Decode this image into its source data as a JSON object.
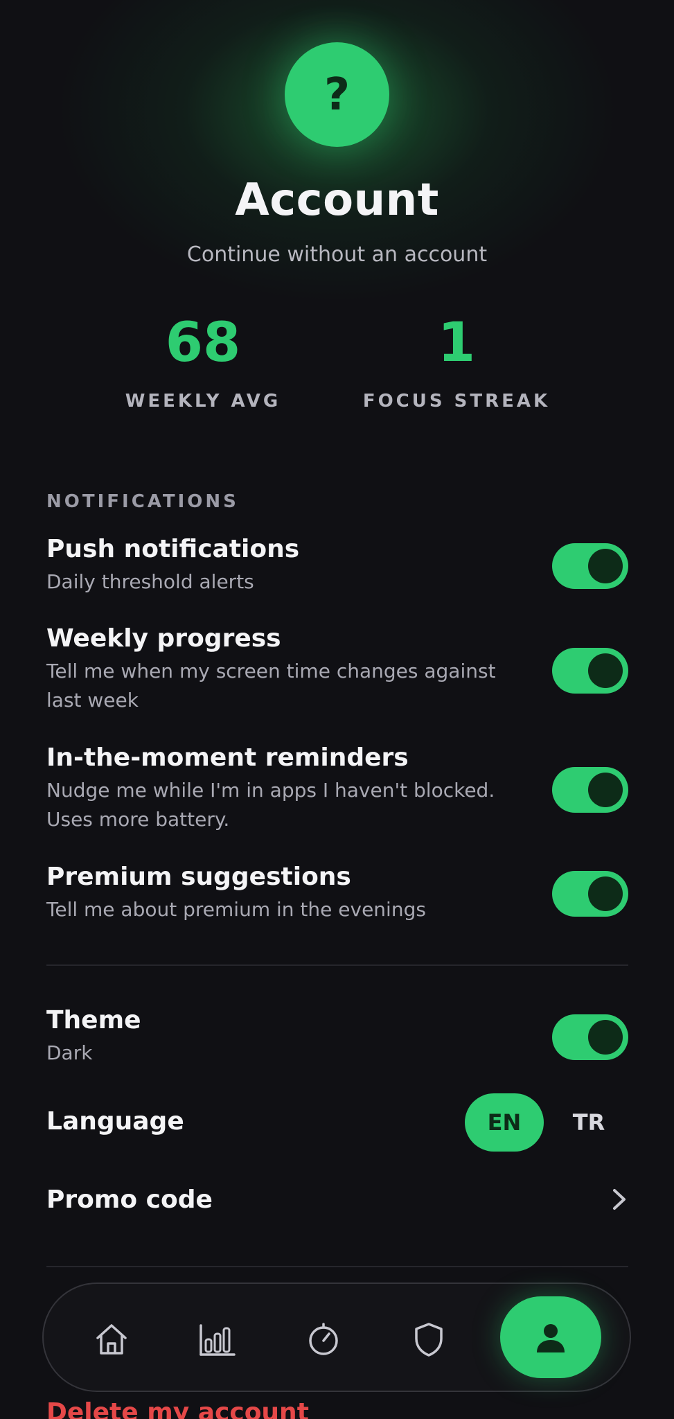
{
  "header": {
    "avatar_glyph": "?",
    "title": "Account",
    "subtitle": "Continue without an account"
  },
  "stats": [
    {
      "value": "68",
      "label": "WEEKLY AVG"
    },
    {
      "value": "1",
      "label": "FOCUS STREAK"
    }
  ],
  "notifications": {
    "section_label": "NOTIFICATIONS",
    "items": [
      {
        "title": "Push notifications",
        "description": "Daily threshold alerts",
        "enabled": true
      },
      {
        "title": "Weekly progress",
        "description": "Tell me when my screen time changes against last week",
        "enabled": true
      },
      {
        "title": "In-the-moment reminders",
        "description": "Nudge me while I'm in apps I haven't blocked. Uses more battery.",
        "enabled": true
      },
      {
        "title": "Premium suggestions",
        "description": "Tell me about premium in the evenings",
        "enabled": true
      }
    ]
  },
  "settings": {
    "theme": {
      "title": "Theme",
      "value": "Dark",
      "enabled": true
    },
    "language": {
      "title": "Language",
      "options": [
        "EN",
        "TR"
      ],
      "selected": "EN"
    },
    "promo": {
      "title": "Promo code"
    }
  },
  "danger": {
    "delete_label": "Delete my account"
  },
  "nav": {
    "items": [
      "home-icon",
      "stats-icon",
      "timer-icon",
      "shield-icon",
      "profile-icon"
    ],
    "active": "profile-icon"
  },
  "colors": {
    "accent": "#2ecc71",
    "background": "#101014",
    "danger": "#e54848",
    "knob": "#0d2b18"
  }
}
